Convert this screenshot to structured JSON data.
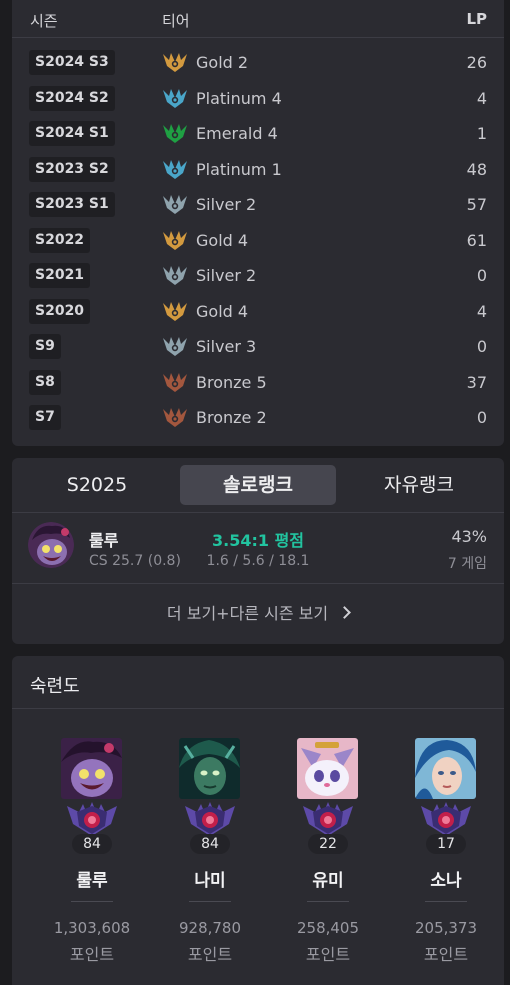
{
  "history": {
    "headers": {
      "season": "시즌",
      "tier": "티어",
      "lp": "LP"
    },
    "rows": [
      {
        "season": "S2024 S3",
        "tier": "Gold 2",
        "lp": "26",
        "tier_color": "#d39a3f"
      },
      {
        "season": "S2024 S2",
        "tier": "Platinum 4",
        "lp": "4",
        "tier_color": "#4aa6c9"
      },
      {
        "season": "S2024 S1",
        "tier": "Emerald 4",
        "lp": "1",
        "tier_color": "#1fa043"
      },
      {
        "season": "S2023 S2",
        "tier": "Platinum 1",
        "lp": "48",
        "tier_color": "#4aa6c9"
      },
      {
        "season": "S2023 S1",
        "tier": "Silver 2",
        "lp": "57",
        "tier_color": "#8fa3ad"
      },
      {
        "season": "S2022",
        "tier": "Gold 4",
        "lp": "61",
        "tier_color": "#d39a3f"
      },
      {
        "season": "S2021",
        "tier": "Silver 2",
        "lp": "0",
        "tier_color": "#8fa3ad"
      },
      {
        "season": "S2020",
        "tier": "Gold 4",
        "lp": "4",
        "tier_color": "#d39a3f"
      },
      {
        "season": "S9",
        "tier": "Silver 3",
        "lp": "0",
        "tier_color": "#8fa3ad"
      },
      {
        "season": "S8",
        "tier": "Bronze 5",
        "lp": "37",
        "tier_color": "#a3573e"
      },
      {
        "season": "S7",
        "tier": "Bronze 2",
        "lp": "0",
        "tier_color": "#a3573e"
      }
    ]
  },
  "summary": {
    "tabs": [
      {
        "label": "S2025",
        "active": false
      },
      {
        "label": "솔로랭크",
        "active": true
      },
      {
        "label": "자유랭크",
        "active": false
      }
    ],
    "champion": {
      "name": "룰루",
      "cs": "CS 25.7 (0.8)",
      "kda_ratio": "3.54:1 평점",
      "kda_detail": "1.6 / 5.6 / 18.1",
      "winrate": "43%",
      "games": "7 게임"
    },
    "more_label": "더 보기+다른 시즌 보기",
    "accent_color": "#22c4a0"
  },
  "mastery": {
    "title": "숙련도",
    "champions": [
      {
        "name": "룰루",
        "level": "84",
        "points": "1,303,608",
        "points_unit": "포인트"
      },
      {
        "name": "나미",
        "level": "84",
        "points": "928,780",
        "points_unit": "포인트"
      },
      {
        "name": "유미",
        "level": "22",
        "points": "258,405",
        "points_unit": "포인트"
      },
      {
        "name": "소나",
        "level": "17",
        "points": "205,373",
        "points_unit": "포인트"
      }
    ]
  }
}
